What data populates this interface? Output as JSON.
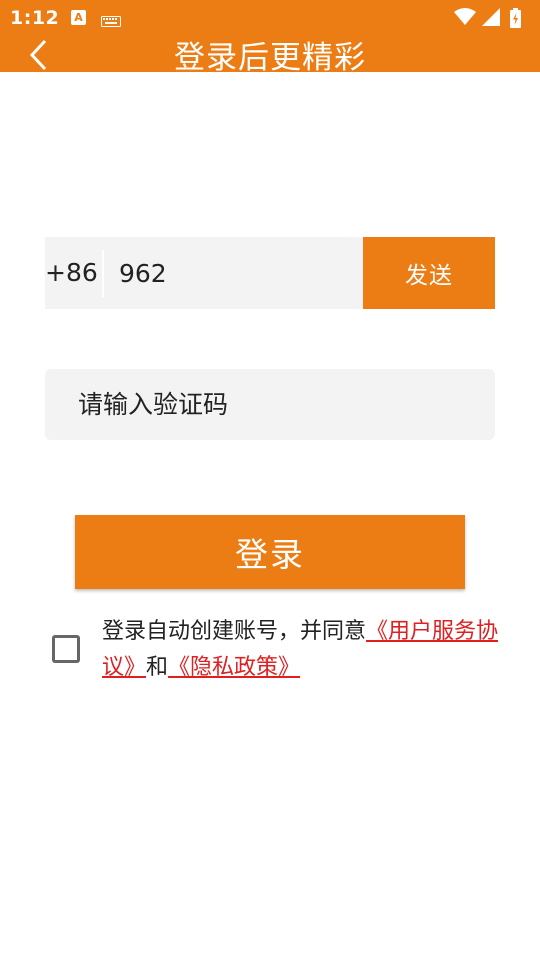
{
  "status_bar": {
    "time": "1:12",
    "icons": [
      "font-a-icon",
      "keyboard-icon",
      "wifi-icon",
      "signal-icon",
      "battery-charging-icon"
    ],
    "background": "#ec7d15"
  },
  "app_bar": {
    "title": "登录后更精彩",
    "back_icon": "chevron-left-icon",
    "background": "#ec7d15"
  },
  "phone": {
    "country_code": "+86",
    "value": "962",
    "send_label": "发送"
  },
  "code": {
    "placeholder": "请输入验证码"
  },
  "login_label": "登录",
  "agreement": {
    "checked": false,
    "prefix": "登录自动创建账号，并同意",
    "link_service": "《用户服务协议》",
    "joiner": "和",
    "link_privacy": "《隐私政策》"
  },
  "colors": {
    "accent": "#ec7d15",
    "input_bg": "#f3f3f3",
    "link": "#e02020"
  }
}
